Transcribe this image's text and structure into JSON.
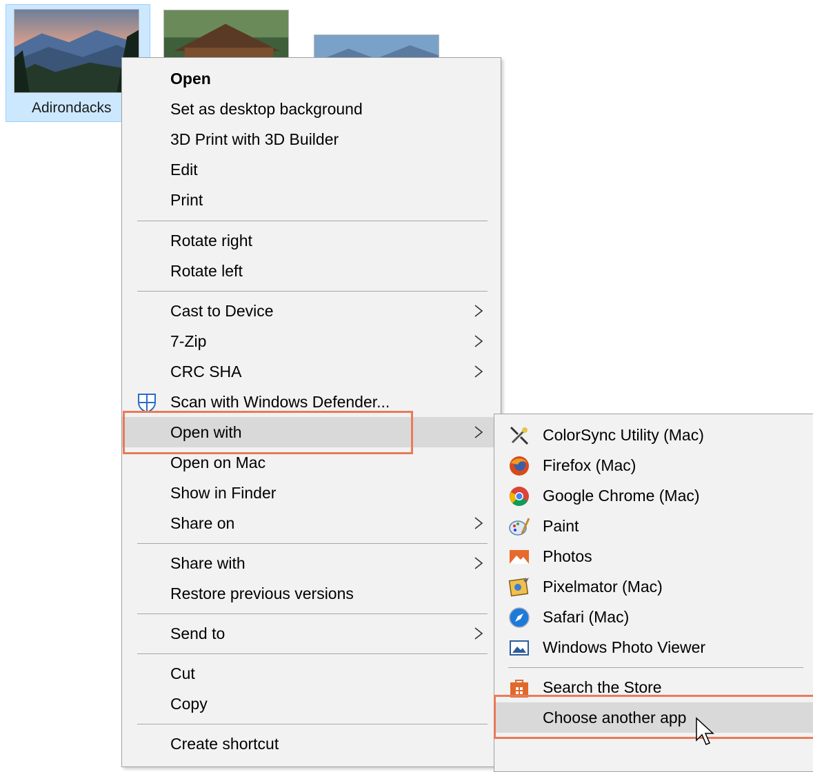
{
  "desktop": {
    "file_label": "Adirondacks"
  },
  "context_menu": {
    "items": [
      {
        "label": "Open"
      },
      {
        "label": "Set as desktop background"
      },
      {
        "label": "3D Print with 3D Builder"
      },
      {
        "label": "Edit"
      },
      {
        "label": "Print"
      },
      {
        "label": "Rotate right"
      },
      {
        "label": "Rotate left"
      },
      {
        "label": "Cast to Device"
      },
      {
        "label": "7-Zip"
      },
      {
        "label": "CRC SHA"
      },
      {
        "label": "Scan with Windows Defender..."
      },
      {
        "label": "Open with"
      },
      {
        "label": "Open on Mac"
      },
      {
        "label": "Show in Finder"
      },
      {
        "label": "Share on"
      },
      {
        "label": "Share with"
      },
      {
        "label": "Restore previous versions"
      },
      {
        "label": "Send to"
      },
      {
        "label": "Cut"
      },
      {
        "label": "Copy"
      },
      {
        "label": "Create shortcut"
      }
    ]
  },
  "open_with_submenu": {
    "items": [
      {
        "label": "ColorSync Utility (Mac)",
        "icon": "colorsync-icon"
      },
      {
        "label": "Firefox (Mac)",
        "icon": "firefox-icon"
      },
      {
        "label": "Google Chrome (Mac)",
        "icon": "chrome-icon"
      },
      {
        "label": "Paint",
        "icon": "paint-icon"
      },
      {
        "label": "Photos",
        "icon": "photos-icon"
      },
      {
        "label": "Pixelmator (Mac)",
        "icon": "pixelmator-icon"
      },
      {
        "label": "Safari (Mac)",
        "icon": "safari-icon"
      },
      {
        "label": "Windows Photo Viewer",
        "icon": "photo-viewer-icon"
      },
      {
        "label": "Search the Store",
        "icon": "store-icon"
      },
      {
        "label": "Choose another app",
        "icon": ""
      }
    ]
  },
  "colors": {
    "menu_bg": "#f2f2f2",
    "hover_bg": "#d9d9d9",
    "highlight_border": "#e97a58",
    "selection_bg": "#cce8ff"
  }
}
